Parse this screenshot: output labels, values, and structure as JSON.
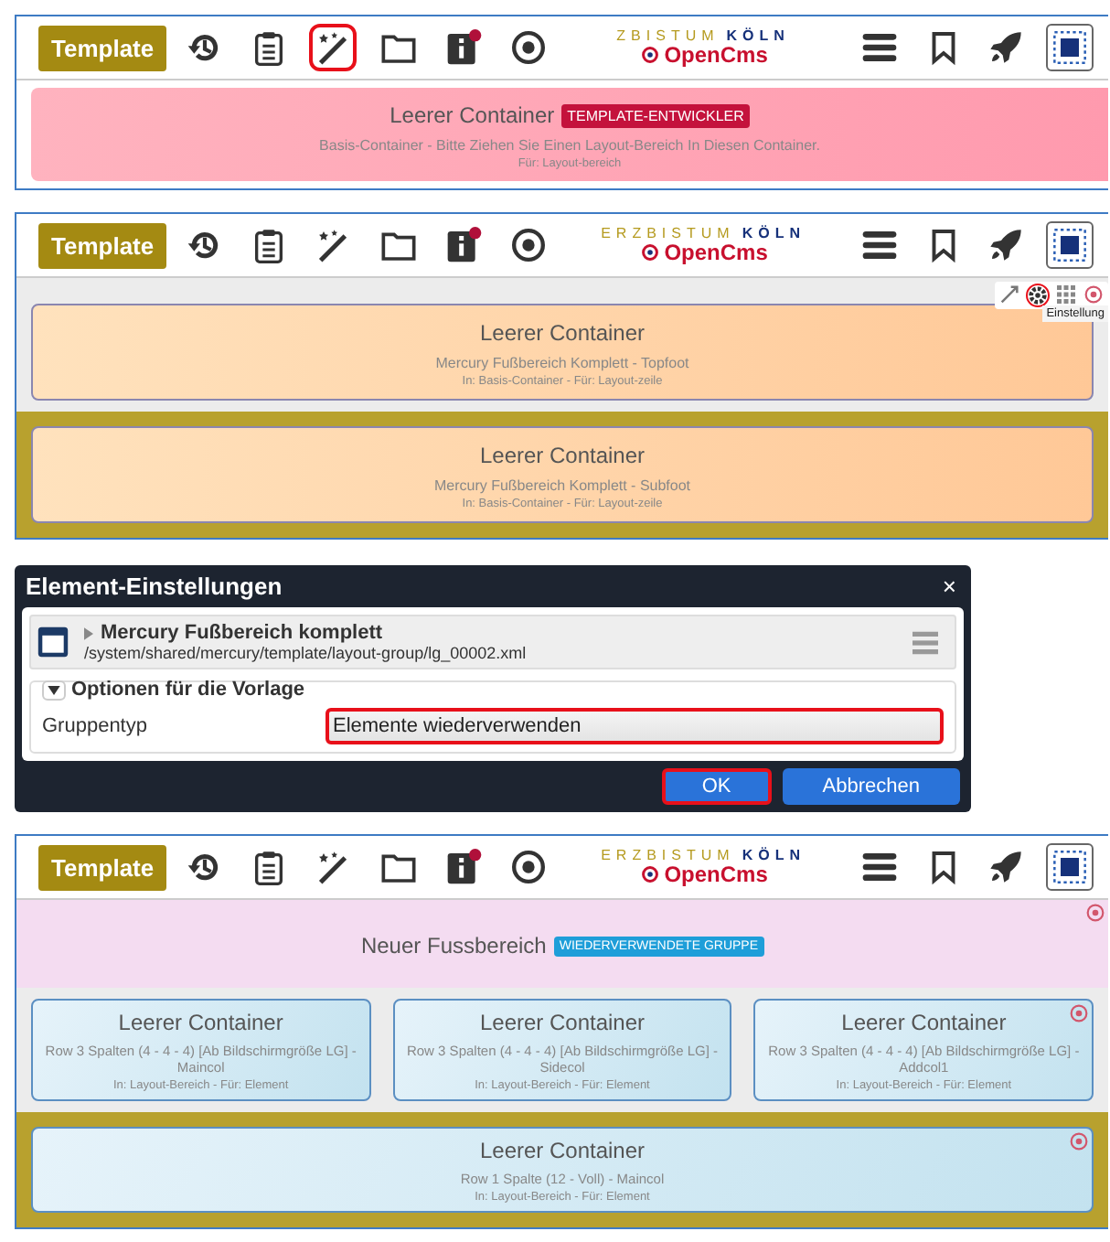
{
  "panels": [
    {
      "kind": "editor",
      "toolbar": {
        "button": "Template",
        "logo_top": [
          "ZBISTUM",
          "KÖLN"
        ],
        "logo_brand": "OpenCms",
        "tools": [
          {
            "kind": "history",
            "highlighted": false
          },
          {
            "kind": "clipboard",
            "highlighted": false
          },
          {
            "kind": "wand",
            "highlighted": true
          },
          {
            "kind": "folder",
            "highlighted": false
          },
          {
            "kind": "info",
            "highlighted": false
          },
          {
            "kind": "target",
            "highlighted": false
          }
        ],
        "actions": [
          {
            "kind": "menu"
          },
          {
            "kind": "bookmark"
          },
          {
            "kind": "rocket"
          },
          {
            "kind": "selection"
          }
        ]
      },
      "sections": [
        {
          "kind": "white",
          "containers": [
            {
              "kind": "pink",
              "title": "Leerer Container",
              "badge": {
                "kind": "template",
                "text": "TEMPLATE-ENTWICKLER"
              },
              "subtitle": "Basis-Container - Bitte Ziehen Sie Einen Layout-Bereich In Diesen Container.",
              "note": "Für: Layout-bereich"
            }
          ]
        }
      ]
    },
    {
      "kind": "editor",
      "toolbar": {
        "button": "Template",
        "logo_top": [
          "ERZBISTUM",
          "KÖLN"
        ],
        "logo_brand": "OpenCms",
        "tools": [
          {
            "kind": "history",
            "highlighted": false
          },
          {
            "kind": "clipboard",
            "highlighted": false
          },
          {
            "kind": "wand",
            "highlighted": false
          },
          {
            "kind": "folder",
            "highlighted": false
          },
          {
            "kind": "info",
            "highlighted": false
          },
          {
            "kind": "target",
            "highlighted": false
          }
        ],
        "actions": [
          {
            "kind": "menu"
          },
          {
            "kind": "bookmark"
          },
          {
            "kind": "rocket"
          },
          {
            "kind": "selection"
          }
        ]
      },
      "sections": [
        {
          "kind": "gray",
          "edit_tools": [
            {
              "kind": "move",
              "highlighted": false
            },
            {
              "kind": "settings",
              "highlighted": true
            },
            {
              "kind": "grid",
              "highlighted": false
            },
            {
              "kind": "remove",
              "highlighted": false
            }
          ],
          "tooltip": "Einstellung",
          "containers": [
            {
              "kind": "orange",
              "title": "Leerer Container",
              "subtitle": "Mercury Fußbereich Komplett - Topfoot",
              "note": "In: Basis-Container - Für: Layout-zeile"
            }
          ]
        },
        {
          "kind": "olive",
          "containers": [
            {
              "kind": "orange",
              "title": "Leerer Container",
              "subtitle": "Mercury Fußbereich Komplett - Subfoot",
              "note": "In: Basis-Container - Für: Layout-zeile"
            }
          ]
        }
      ]
    },
    {
      "kind": "dialog",
      "title": "Element-Einstellungen",
      "close": "×",
      "resource": {
        "title": "Mercury Fußbereich komplett",
        "path": "/system/shared/mercury/template/layout-group/lg_00002.xml"
      },
      "fieldset": {
        "legend": "Optionen für die Vorlage",
        "expanded": true,
        "label": "Gruppentyp",
        "value": "Elemente wiederverwenden",
        "highlighted": true
      },
      "buttons": [
        {
          "label": "OK",
          "highlighted": true
        },
        {
          "label": "Abbrechen",
          "highlighted": false
        }
      ]
    },
    {
      "kind": "editor",
      "toolbar": {
        "button": "Template",
        "logo_top": [
          "ERZBISTUM",
          "KÖLN"
        ],
        "logo_brand": "OpenCms",
        "tools": [
          {
            "kind": "history",
            "highlighted": false
          },
          {
            "kind": "clipboard",
            "highlighted": false
          },
          {
            "kind": "wand",
            "highlighted": false
          },
          {
            "kind": "folder",
            "highlighted": false
          },
          {
            "kind": "info",
            "highlighted": false
          },
          {
            "kind": "target",
            "highlighted": false
          }
        ],
        "actions": [
          {
            "kind": "menu"
          },
          {
            "kind": "bookmark"
          },
          {
            "kind": "rocket"
          },
          {
            "kind": "selection"
          }
        ]
      },
      "sections": [
        {
          "kind": "lilac",
          "containers": [
            {
              "kind": "group",
              "title": "Neuer Fussbereich",
              "badge": {
                "kind": "reused",
                "text": "WIEDERVERWENDETE GRUPPE"
              },
              "marker": true
            }
          ]
        },
        {
          "kind": "gray",
          "containers": [
            {
              "kind": "blue",
              "title": "Leerer Container",
              "subtitle": "Row 3 Spalten (4 - 4 - 4) [Ab Bildschirmgröße LG] - Maincol",
              "note": "In: Layout-Bereich - Für: Element"
            },
            {
              "kind": "blue",
              "title": "Leerer Container",
              "subtitle": "Row 3 Spalten (4 - 4 - 4) [Ab Bildschirmgröße LG] - Sidecol",
              "note": "In: Layout-Bereich - Für: Element"
            },
            {
              "kind": "blue",
              "title": "Leerer Container",
              "subtitle": "Row 3 Spalten (4 - 4 - 4) [Ab Bildschirmgröße LG] - Addcol1",
              "note": "In: Layout-Bereich - Für: Element",
              "marker": true
            }
          ]
        },
        {
          "kind": "olive",
          "containers": [
            {
              "kind": "blue",
              "title": "Leerer Container",
              "subtitle": "Row 1 Spalte (12 - Voll) - Maincol",
              "note": "In: Layout-Bereich - Für: Element",
              "marker": true
            }
          ]
        }
      ]
    }
  ]
}
